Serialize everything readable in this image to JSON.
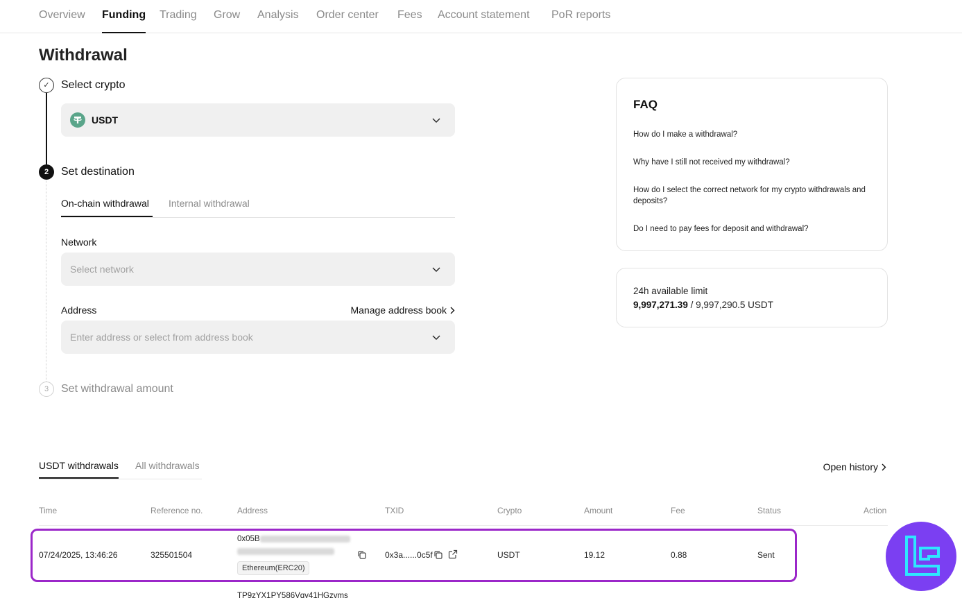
{
  "nav": {
    "tabs": [
      {
        "label": "Overview"
      },
      {
        "label": "Funding"
      },
      {
        "label": "Trading"
      },
      {
        "label": "Grow"
      },
      {
        "label": "Analysis"
      },
      {
        "label": "Order center"
      },
      {
        "label": "Fees"
      },
      {
        "label": "Account statement"
      },
      {
        "label": "PoR reports"
      }
    ],
    "active": "Funding"
  },
  "page": {
    "title": "Withdrawal"
  },
  "steps": [
    {
      "number": "✓",
      "title": "Select crypto",
      "state": "done"
    },
    {
      "number": "2",
      "title": "Set destination",
      "state": "active"
    },
    {
      "number": "3",
      "title": "Set withdrawal amount",
      "state": "pending"
    }
  ],
  "crypto_select": {
    "value": "USDT",
    "icon": "tether-icon"
  },
  "destination": {
    "tabs": [
      {
        "label": "On-chain withdrawal"
      },
      {
        "label": "Internal withdrawal"
      }
    ],
    "active_tab": "On-chain withdrawal",
    "network": {
      "label": "Network",
      "placeholder": "Select network"
    },
    "address": {
      "label": "Address",
      "placeholder": "Enter address or select from address book",
      "manage_link": "Manage address book"
    }
  },
  "faq": {
    "title": "FAQ",
    "items": [
      "How do I make a withdrawal?",
      "Why have I still not received my withdrawal?",
      "How do I select the correct network for my crypto withdrawals and deposits?",
      "Do I need to pay fees for deposit and withdrawal?"
    ]
  },
  "limit": {
    "title": "24h available limit",
    "available": "9,997,271.39",
    "total": " / 9,997,290.5 USDT"
  },
  "history": {
    "tabs": [
      {
        "label": "USDT withdrawals"
      },
      {
        "label": "All withdrawals"
      }
    ],
    "active_tab": "USDT withdrawals",
    "open_history": "Open history",
    "columns": [
      "Time",
      "Reference no.",
      "Address",
      "TXID",
      "Crypto",
      "Amount",
      "Fee",
      "Status",
      "Action"
    ],
    "rows": [
      {
        "time": "07/24/2025, 13:46:26",
        "reference": "325501504",
        "address_prefix": "0x05B",
        "network": "Ethereum(ERC20)",
        "txid": "0x3a......0c5f",
        "crypto": "USDT",
        "amount": "19.12",
        "fee": "0.88",
        "status": "Sent"
      }
    ],
    "next_row_address": "TP9zYX1PY586Vqy41HGzvms"
  },
  "colors": {
    "accent": "#111111",
    "highlight": "#9b27c9",
    "brand_logo": "#7b3ff2",
    "tether": "#5aa58a"
  }
}
